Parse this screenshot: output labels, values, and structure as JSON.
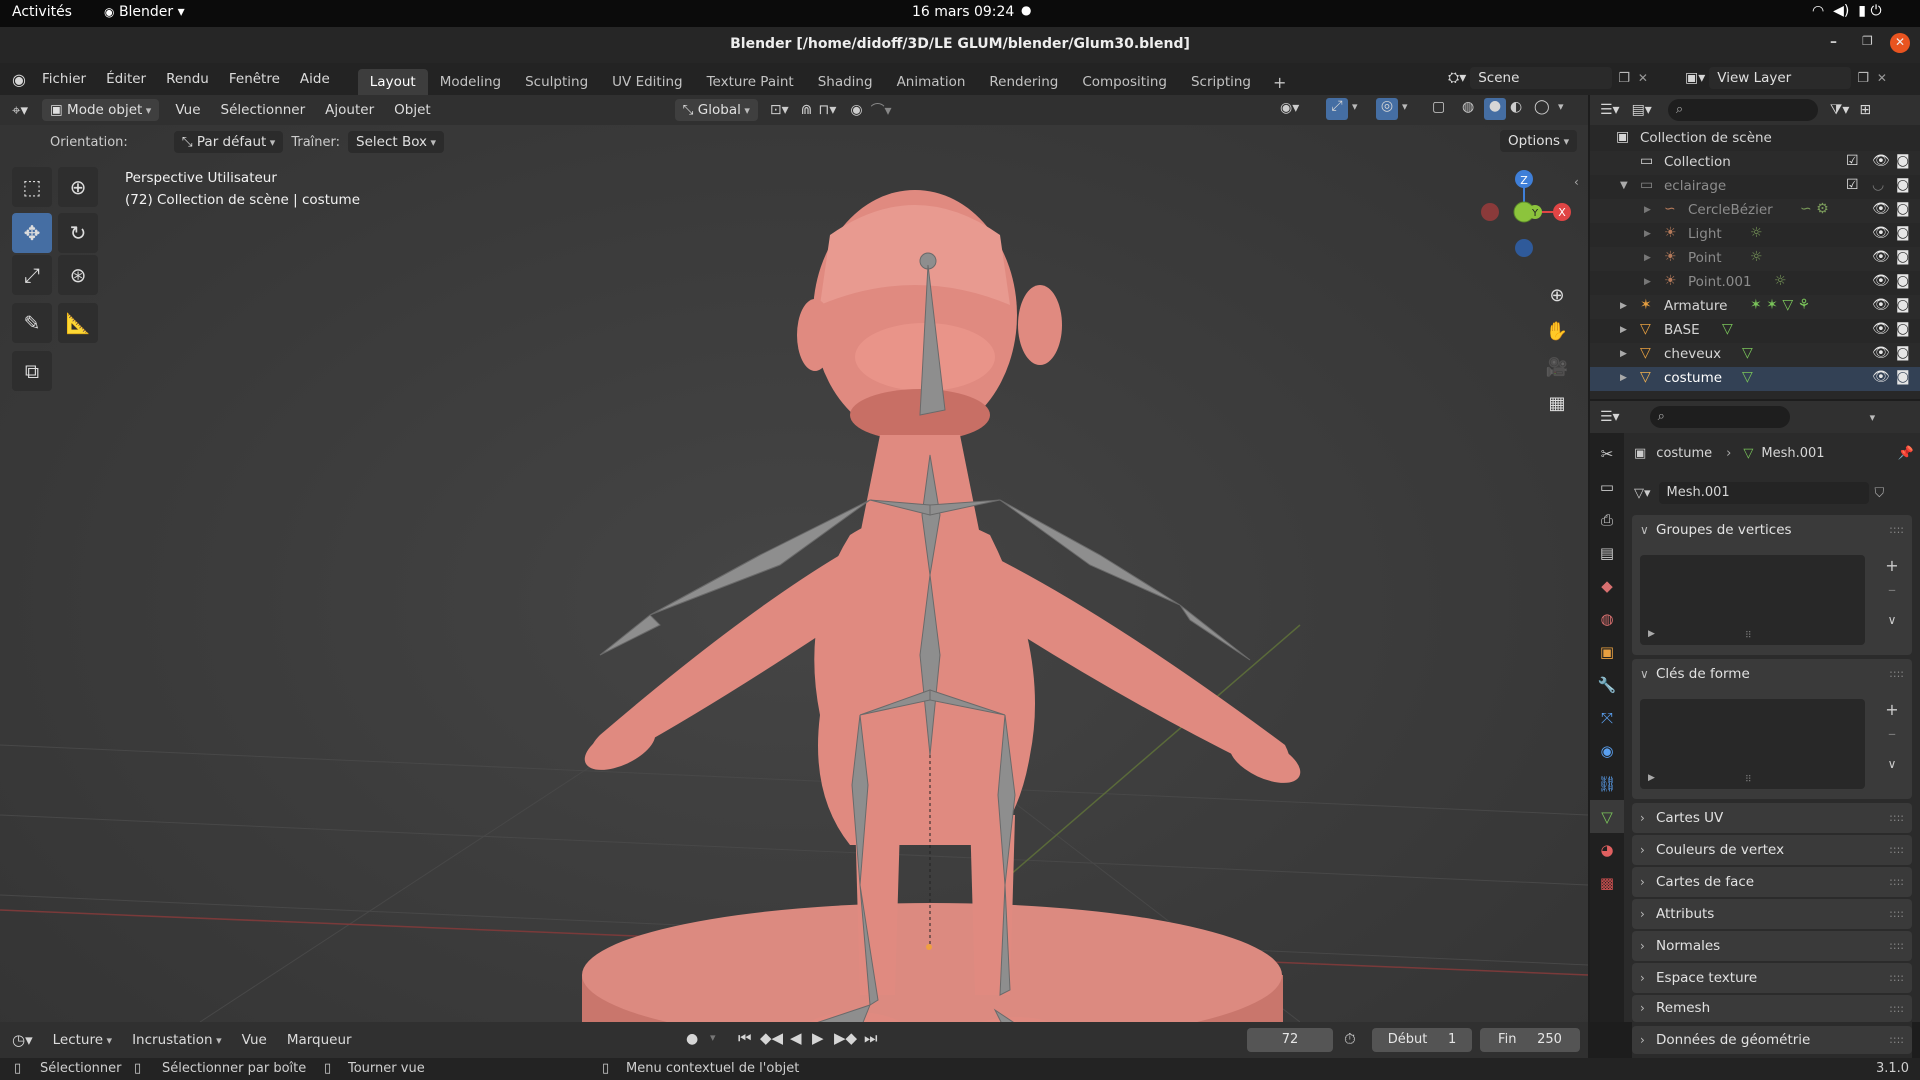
{
  "gnome": {
    "activities": "Activités",
    "app": "Blender",
    "datetime": "16 mars  09:24"
  },
  "window": {
    "title": "Blender [/home/didoff/3D/LE GLUM/blender/Glum30.blend]"
  },
  "menus": [
    "Fichier",
    "Éditer",
    "Rendu",
    "Fenêtre",
    "Aide"
  ],
  "workspaces": [
    "Layout",
    "Modeling",
    "Sculpting",
    "UV Editing",
    "Texture Paint",
    "Shading",
    "Animation",
    "Rendering",
    "Compositing",
    "Scripting"
  ],
  "scene": {
    "name": "Scene",
    "view_layer": "View Layer"
  },
  "viewport": {
    "mode": "Mode objet",
    "menus": [
      "Vue",
      "Sélectionner",
      "Ajouter",
      "Objet"
    ],
    "transform": "Global",
    "orientation_label": "Orientation:",
    "orientation_value": "Par défaut",
    "drag_label": "Traîner:",
    "drag_value": "Select Box",
    "options": "Options",
    "info_line1": "Perspective Utilisateur",
    "info_line2": "(72) Collection de scène | costume",
    "gizmo": {
      "x": "X",
      "y": "Y",
      "z": "Z"
    }
  },
  "outliner": {
    "rows": [
      {
        "label": "Collection de scène",
        "indent": 0,
        "icon": "scene-collection-icon"
      },
      {
        "label": "Collection",
        "indent": 1,
        "icon": "collection-icon",
        "checkbox": true
      },
      {
        "label": "eclairage",
        "indent": 1,
        "icon": "collection-icon",
        "checkbox": true,
        "expanded": true,
        "dim": true
      },
      {
        "label": "CercleBézier",
        "indent": 2,
        "icon": "curve-icon",
        "dim": true
      },
      {
        "label": "Light",
        "indent": 2,
        "icon": "light-icon",
        "dim": true
      },
      {
        "label": "Point",
        "indent": 2,
        "icon": "light-icon",
        "dim": true
      },
      {
        "label": "Point.001",
        "indent": 2,
        "icon": "light-icon",
        "dim": true
      },
      {
        "label": "Armature",
        "indent": 1,
        "icon": "armature-icon"
      },
      {
        "label": "BASE",
        "indent": 1,
        "icon": "mesh-icon"
      },
      {
        "label": "cheveux",
        "indent": 1,
        "icon": "mesh-icon"
      },
      {
        "label": "costume",
        "indent": 1,
        "icon": "mesh-icon"
      }
    ]
  },
  "properties": {
    "breadcrumb_object": "costume",
    "breadcrumb_data": "Mesh.001",
    "mesh_name": "Mesh.001",
    "panels": {
      "vertex_groups": "Groupes de vertices",
      "shape_keys": "Clés de forme",
      "uv_maps": "Cartes UV",
      "vertex_colors": "Couleurs de vertex",
      "face_maps": "Cartes de face",
      "attributes": "Attributs",
      "normals": "Normales",
      "texture_space": "Espace texture",
      "remesh": "Remesh",
      "geometry_data": "Données de géométrie"
    }
  },
  "timeline": {
    "menus": [
      "Lecture",
      "Incrustation",
      "Vue",
      "Marqueur"
    ],
    "current_frame": "72",
    "start_label": "Début",
    "start": "1",
    "end_label": "Fin",
    "end": "250"
  },
  "status": {
    "select": "Sélectionner",
    "box_select": "Sélectionner par boîte",
    "rotate": "Tourner vue",
    "context_menu": "Menu contextuel de l'objet",
    "version": "3.1.0"
  },
  "colors": {
    "accent": "#456ea3",
    "skin": "#e08a80",
    "bone": "#8a8a8a",
    "x_axis": "#e04545",
    "y_axis": "#8cc43c",
    "z_axis": "#3f7fd8"
  }
}
